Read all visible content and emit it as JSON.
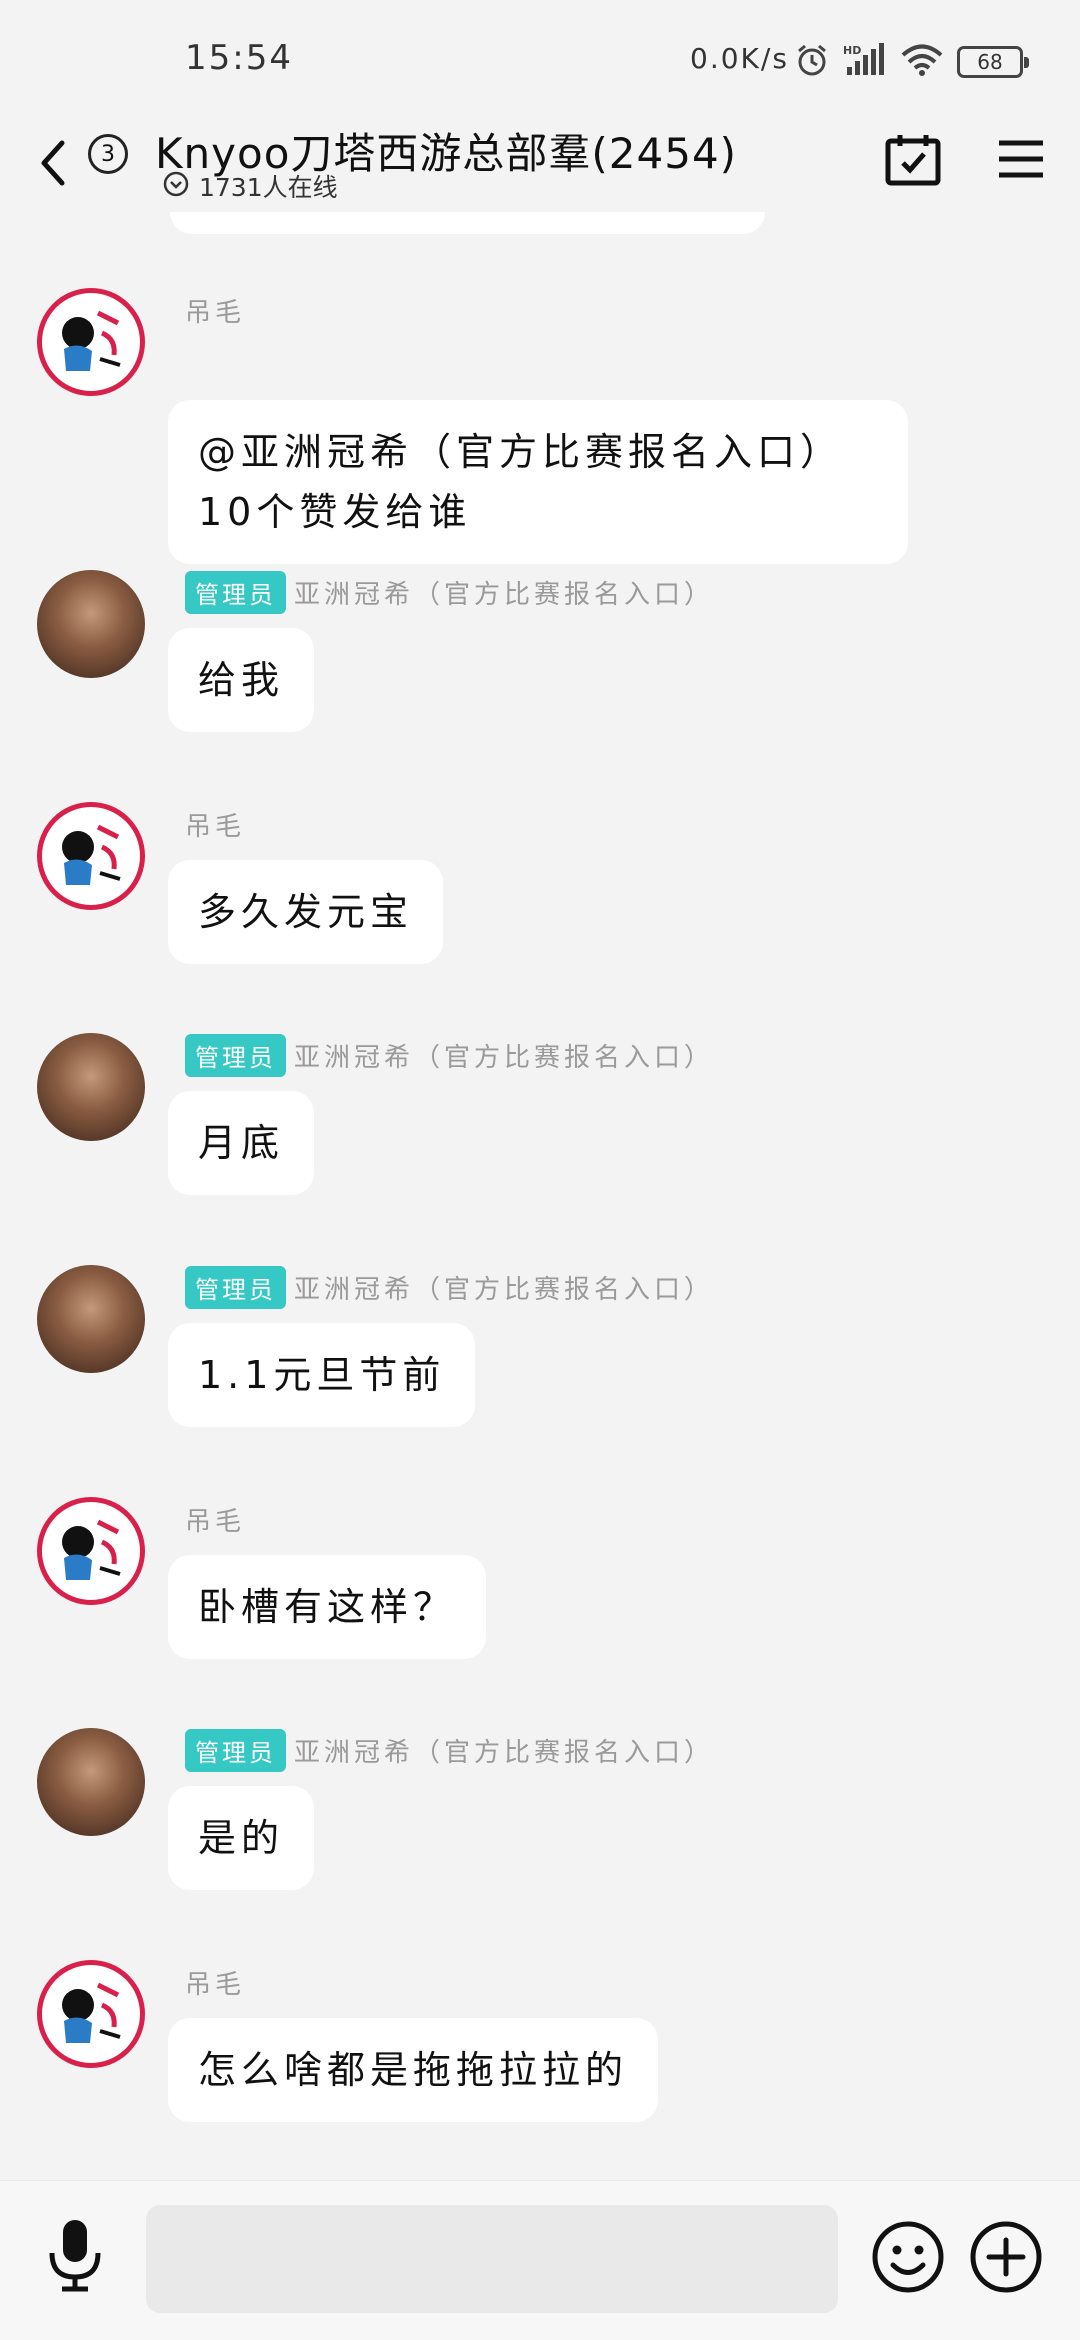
{
  "status_bar": {
    "time": "15:54",
    "net_speed": "0.0K/s",
    "battery": "68",
    "icons": [
      "alarm-icon",
      "hd-signal-icon",
      "wifi-icon",
      "battery-icon"
    ]
  },
  "header": {
    "unread_count": "3",
    "title": "Knyoo刀塔西游总部羣(2454)",
    "online_count": "1731人在线",
    "icons": [
      "back-icon",
      "calendar-check-icon",
      "menu-icon"
    ]
  },
  "messages": [
    {
      "sender": "吊毛",
      "admin_badge": "",
      "avatar": "logo",
      "text": "@亚洲冠希（官方比赛报名入口）\n10个赞发给谁"
    },
    {
      "sender": "亚洲冠希（官方比赛报名入口）",
      "admin_badge": "管理员",
      "avatar": "photo",
      "text": "给我"
    },
    {
      "sender": "吊毛",
      "admin_badge": "",
      "avatar": "logo",
      "text": "多久发元宝"
    },
    {
      "sender": "亚洲冠希（官方比赛报名入口）",
      "admin_badge": "管理员",
      "avatar": "photo",
      "text": "月底"
    },
    {
      "sender": "亚洲冠希（官方比赛报名入口）",
      "admin_badge": "管理员",
      "avatar": "photo",
      "text": "1.1元旦节前"
    },
    {
      "sender": "吊毛",
      "admin_badge": "",
      "avatar": "logo",
      "text": "卧槽有这样？"
    },
    {
      "sender": "亚洲冠希（官方比赛报名入口）",
      "admin_badge": "管理员",
      "avatar": "photo",
      "text": "是的"
    },
    {
      "sender": "吊毛",
      "admin_badge": "",
      "avatar": "logo",
      "text": "怎么啥都是拖拖拉拉的"
    }
  ],
  "input_bar": {
    "placeholder": "",
    "icons": [
      "microphone-icon",
      "emoji-icon",
      "plus-icon"
    ]
  }
}
